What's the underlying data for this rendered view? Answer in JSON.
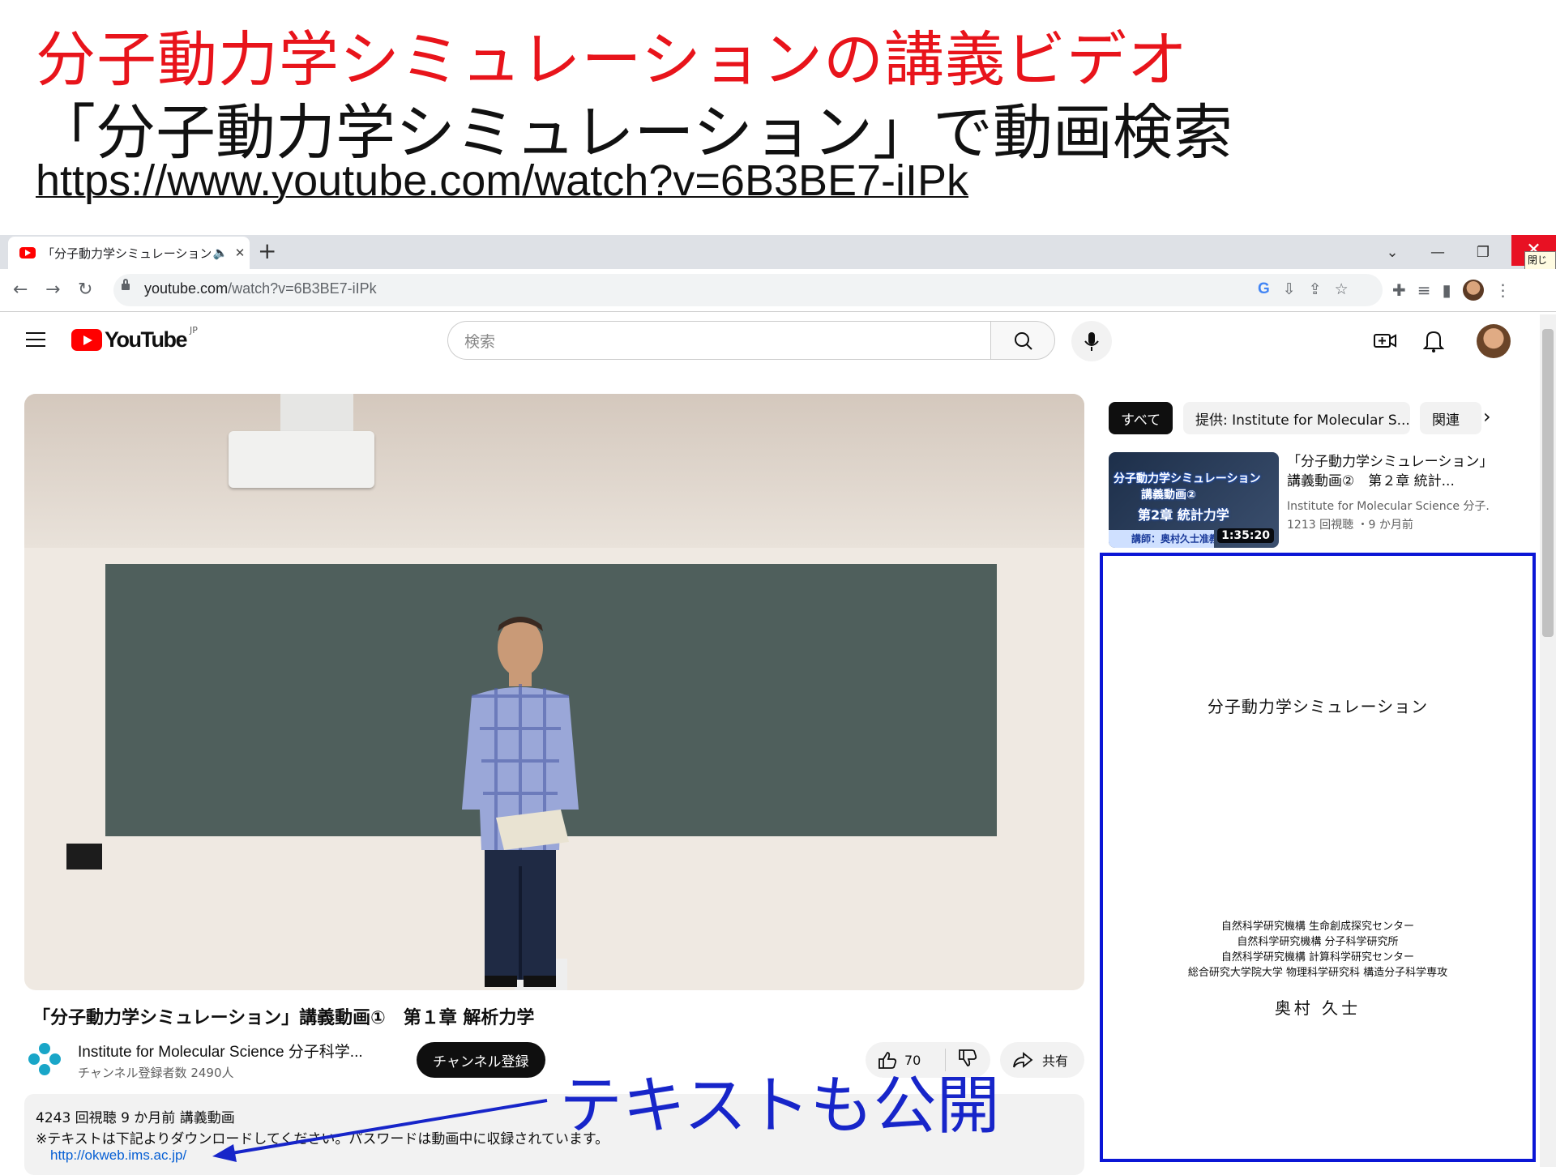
{
  "slide": {
    "title": "分子動力学シミュレーションの講義ビデオ",
    "subtitle": "「分子動力学シミュレーション」で動画検索",
    "url": "https://www.youtube.com/watch?v=6B3BE7-iIPk"
  },
  "browser": {
    "tab_title": "「分子動力学シミュレーション」講",
    "new_tab": "+",
    "address_host": "youtube.com",
    "address_path": "/watch?v=6B3BE7-iIPk",
    "close_tooltip": "閉じる"
  },
  "youtube": {
    "logo_text": "YouTube",
    "country_code": "JP",
    "search_placeholder": "検索"
  },
  "video": {
    "title": "「分子動力学シミュレーション」講義動画①　第１章 解析力学",
    "channel_name": "Institute for Molecular Science 分子科学...",
    "subscriber_count": "チャンネル登録者数 2490人",
    "subscribe_label": "チャンネル登録",
    "like_count": "70",
    "share_label": "共有",
    "description_meta": "4243 回視聴  9 か月前  講義動画",
    "description_note": "※テキストは下記よりダウンロードしてください。パスワードは動画中に収録されています。",
    "description_link": "http://okweb.ims.ac.jp/"
  },
  "annotation": {
    "text": "テキストも公開"
  },
  "sidebar": {
    "chips": [
      "すべて",
      "提供: Institute for Molecular S...",
      "関連"
    ],
    "recommendation": {
      "title": "「分子動力学シミュレーション」講義動画②　第２章 統計...",
      "channel": "Institute for Molecular Science 分子...",
      "meta": "1213 回視聴 ・9 か月前",
      "duration": "1:35:20",
      "thumb_line1": "分子動力学シミュレーション",
      "thumb_line2": "講義動画②",
      "thumb_line3": "第2章 統計力学",
      "thumb_line4": "講師：奥村久士准教"
    }
  },
  "document": {
    "title": "分子動力学シミュレーション",
    "affiliations": [
      "自然科学研究機構 生命創成探究センター",
      "自然科学研究機構 分子科学研究所",
      "自然科学研究機構 計算科学研究センター",
      "総合研究大学院大学 物理科学研究科 構造分子科学専攻"
    ],
    "author": "奥村 久士"
  },
  "colors": {
    "slide_title": "#e8141b",
    "annotation": "#1725c9",
    "youtube_red": "#ff0000",
    "link": "#065fd4"
  }
}
